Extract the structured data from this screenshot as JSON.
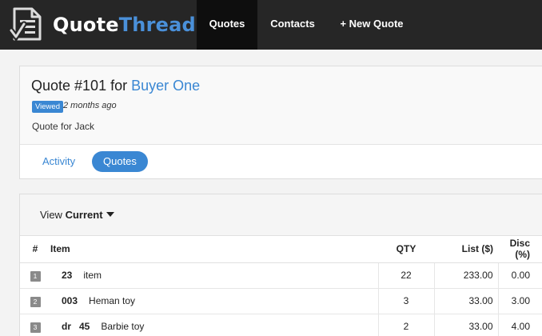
{
  "brand": {
    "name_part1": "Quote",
    "name_part2": "Thread"
  },
  "nav": {
    "quotes": "Quotes",
    "contacts": "Contacts",
    "new_quote": "+ New Quote"
  },
  "quote": {
    "title_prefix": "Quote #101 for",
    "buyer": "Buyer One",
    "status_badge": "Viewed",
    "viewed_time": "2 months ago",
    "description": "Quote for Jack"
  },
  "tabs": {
    "activity": "Activity",
    "quotes": "Quotes"
  },
  "toolbar": {
    "view_label": "View",
    "view_value": "Current"
  },
  "table": {
    "headers": {
      "num": "#",
      "item": "Item",
      "qty": "QTY",
      "list": "List ($)",
      "disc": "Disc (%)"
    },
    "rows": [
      {
        "num": "1",
        "sku": "23",
        "desc": "item",
        "qty": "22",
        "list": "233.00",
        "disc": "0.00"
      },
      {
        "num": "2",
        "sku": "003",
        "desc": "Heman toy",
        "qty": "3",
        "list": "33.00",
        "disc": "3.00"
      },
      {
        "num": "3",
        "sku": "dr   45",
        "desc": "Barbie toy",
        "qty": "2",
        "list": "33.00",
        "disc": "4.00"
      }
    ]
  },
  "colors": {
    "accent": "#3a87d3",
    "topbar": "#262626"
  }
}
